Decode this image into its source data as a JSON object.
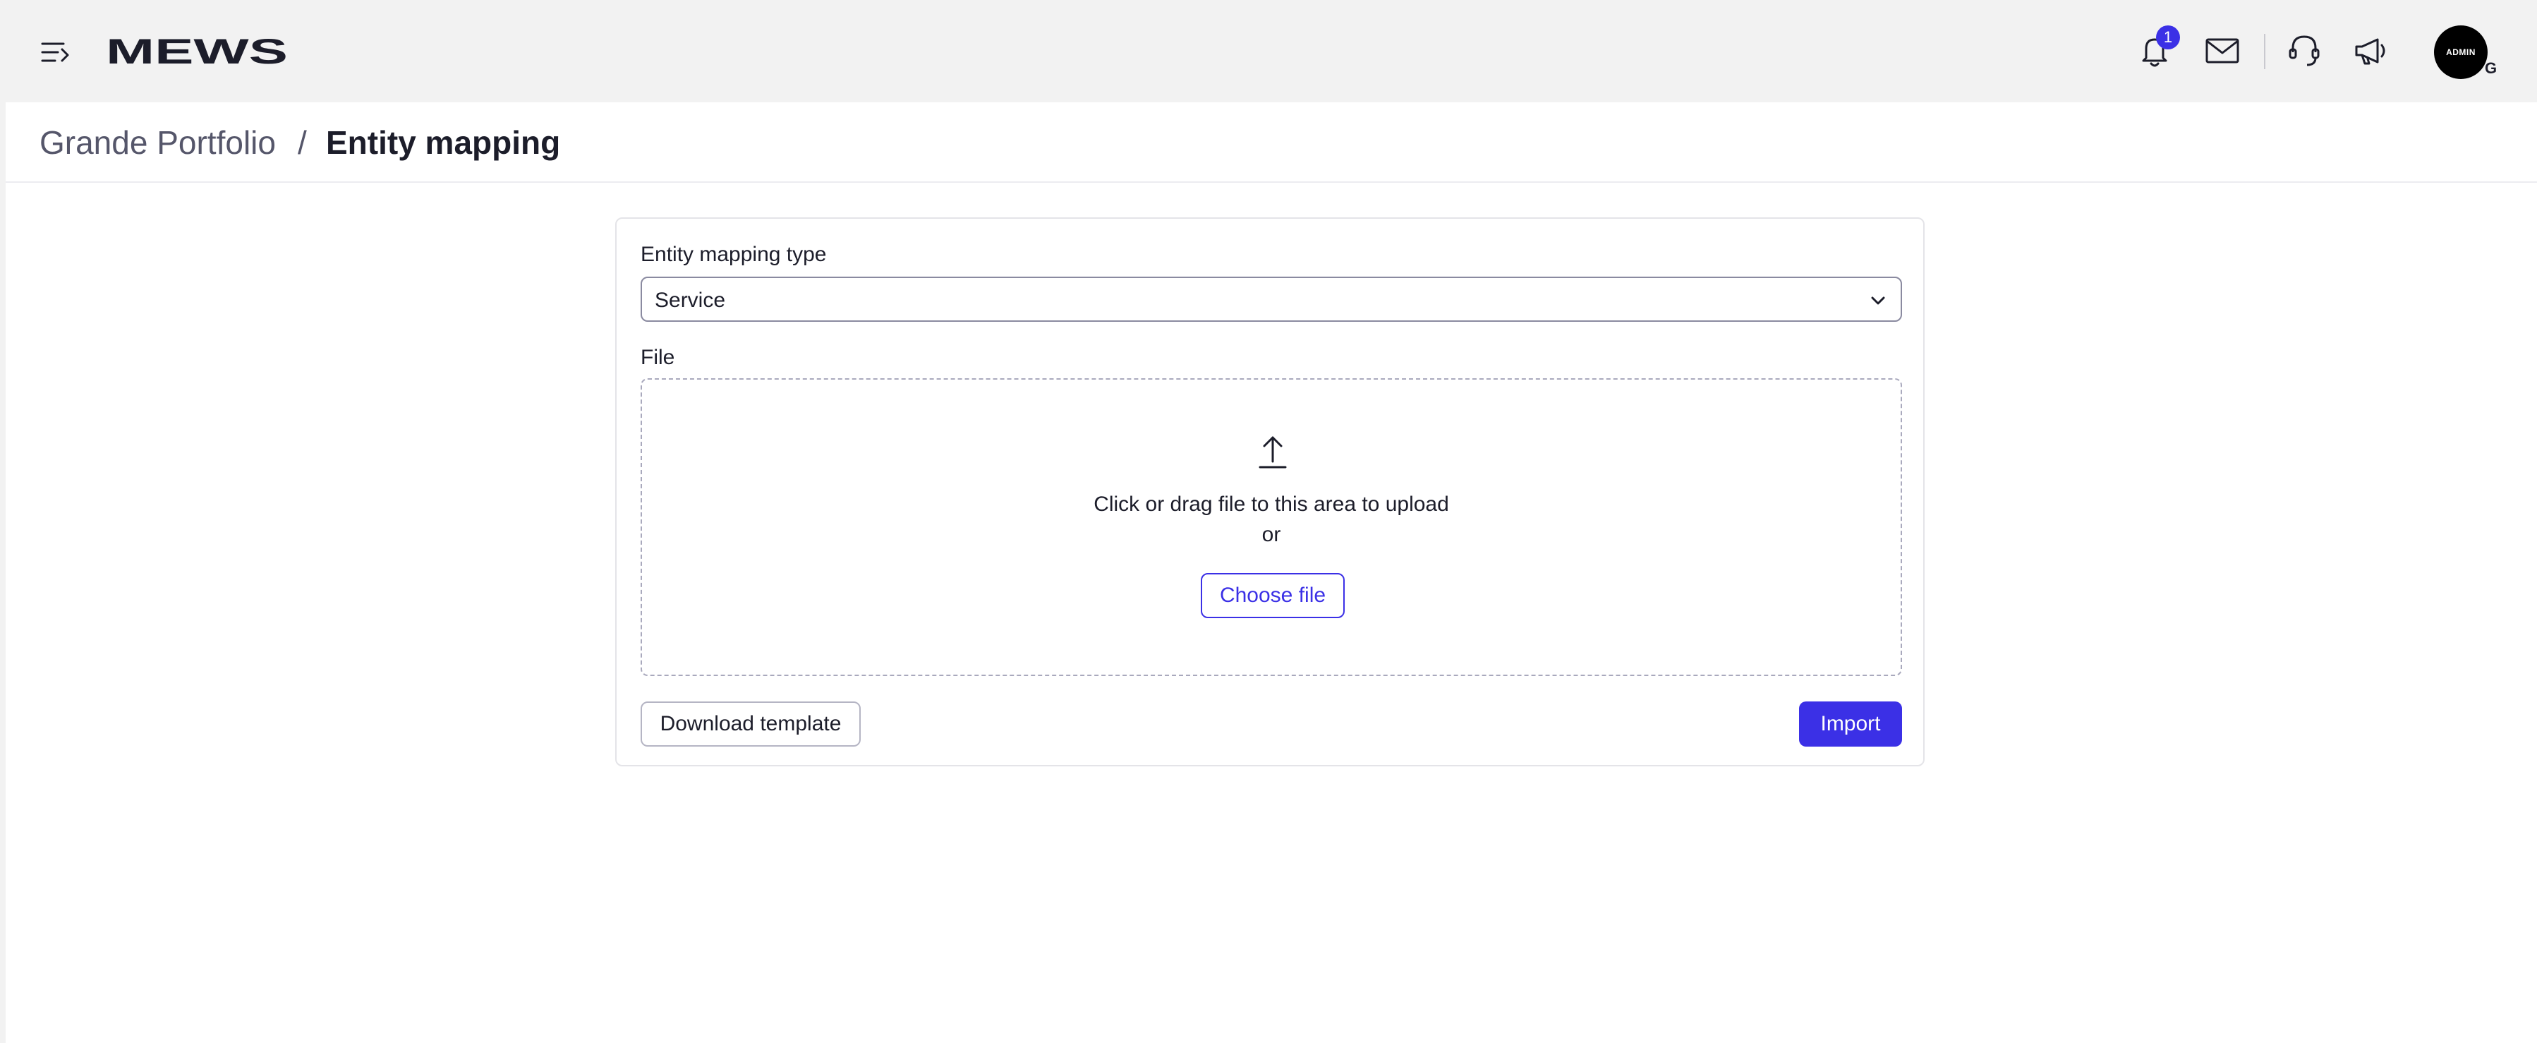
{
  "header": {
    "logo_text": "MEWS",
    "notification_count": "1",
    "avatar_label": "ADMIN",
    "avatar_initial": "G",
    "icons": [
      "menu-icon",
      "bell-icon",
      "mail-icon",
      "support-icon",
      "megaphone-icon"
    ]
  },
  "breadcrumb": {
    "parent": "Grande Portfolio",
    "separator": "/",
    "current": "Entity mapping"
  },
  "form": {
    "type_label": "Entity mapping type",
    "type_value": "Service",
    "file_label": "File",
    "dropzone_text": "Click or drag file to this area to upload",
    "dropzone_or": "or",
    "choose_file_label": "Choose file",
    "download_template_label": "Download template",
    "import_label": "Import"
  },
  "colors": {
    "accent": "#3b30e6",
    "page_bg": "#f2f2f2",
    "panel_bg": "#ffffff",
    "text": "#1c1d2a"
  }
}
